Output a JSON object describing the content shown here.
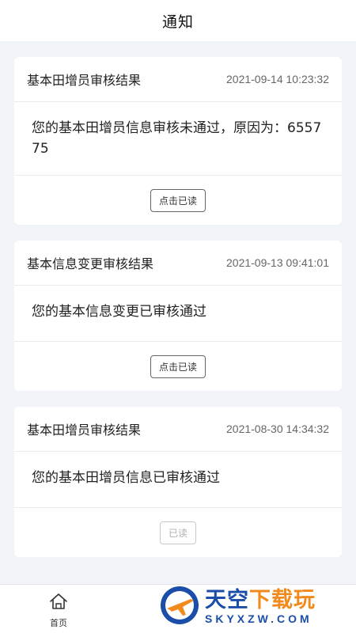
{
  "header": {
    "title": "通知"
  },
  "notifications": [
    {
      "title": "基本田增员审核结果",
      "time": "2021-09-14 10:23:32",
      "content": "您的基本田增员信息审核未通过，原因为：655775",
      "button_label": "点击已读",
      "read": false
    },
    {
      "title": "基本信息变更审核结果",
      "time": "2021-09-13 09:41:01",
      "content": "您的基本信息变更已审核通过",
      "button_label": "点击已读",
      "read": false
    },
    {
      "title": "基本田增员审核结果",
      "time": "2021-08-30 14:34:32",
      "content": "您的基本田增员信息已审核通过",
      "button_label": "已读",
      "read": true
    }
  ],
  "tabbar": {
    "home_label": "首页",
    "home_icon": "home-icon"
  },
  "watermark": {
    "main_blue": "天空",
    "main_orange": "下载玩",
    "sub": "SKYXZW.COM"
  },
  "colors": {
    "background": "#f1f4f9",
    "watermark_blue": "#1a4ea8",
    "watermark_orange": "#f18a1c"
  }
}
